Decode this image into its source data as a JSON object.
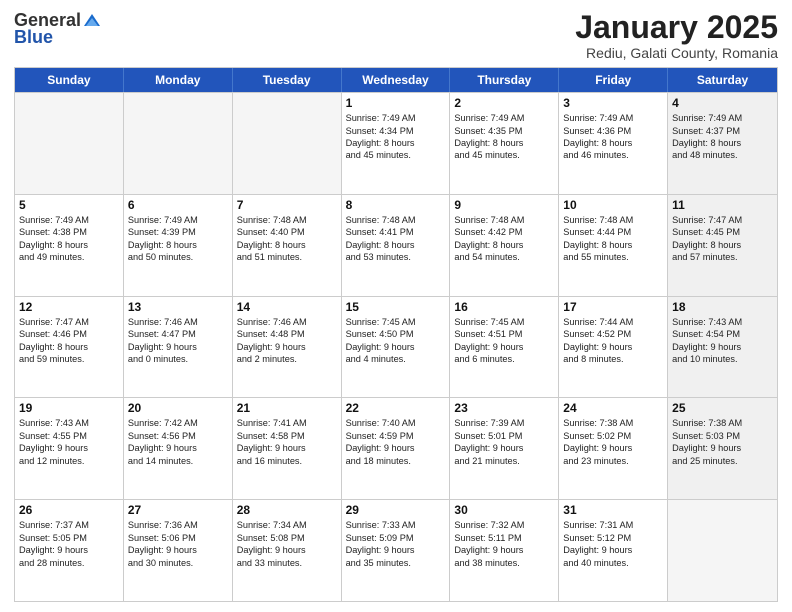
{
  "logo": {
    "general": "General",
    "blue": "Blue"
  },
  "title": "January 2025",
  "subtitle": "Rediu, Galati County, Romania",
  "headers": [
    "Sunday",
    "Monday",
    "Tuesday",
    "Wednesday",
    "Thursday",
    "Friday",
    "Saturday"
  ],
  "weeks": [
    [
      {
        "day": "",
        "lines": [],
        "empty": true
      },
      {
        "day": "",
        "lines": [],
        "empty": true
      },
      {
        "day": "",
        "lines": [],
        "empty": true
      },
      {
        "day": "1",
        "lines": [
          "Sunrise: 7:49 AM",
          "Sunset: 4:34 PM",
          "Daylight: 8 hours",
          "and 45 minutes."
        ],
        "empty": false
      },
      {
        "day": "2",
        "lines": [
          "Sunrise: 7:49 AM",
          "Sunset: 4:35 PM",
          "Daylight: 8 hours",
          "and 45 minutes."
        ],
        "empty": false
      },
      {
        "day": "3",
        "lines": [
          "Sunrise: 7:49 AM",
          "Sunset: 4:36 PM",
          "Daylight: 8 hours",
          "and 46 minutes."
        ],
        "empty": false
      },
      {
        "day": "4",
        "lines": [
          "Sunrise: 7:49 AM",
          "Sunset: 4:37 PM",
          "Daylight: 8 hours",
          "and 48 minutes."
        ],
        "empty": false,
        "shaded": true
      }
    ],
    [
      {
        "day": "5",
        "lines": [
          "Sunrise: 7:49 AM",
          "Sunset: 4:38 PM",
          "Daylight: 8 hours",
          "and 49 minutes."
        ],
        "empty": false
      },
      {
        "day": "6",
        "lines": [
          "Sunrise: 7:49 AM",
          "Sunset: 4:39 PM",
          "Daylight: 8 hours",
          "and 50 minutes."
        ],
        "empty": false
      },
      {
        "day": "7",
        "lines": [
          "Sunrise: 7:48 AM",
          "Sunset: 4:40 PM",
          "Daylight: 8 hours",
          "and 51 minutes."
        ],
        "empty": false
      },
      {
        "day": "8",
        "lines": [
          "Sunrise: 7:48 AM",
          "Sunset: 4:41 PM",
          "Daylight: 8 hours",
          "and 53 minutes."
        ],
        "empty": false
      },
      {
        "day": "9",
        "lines": [
          "Sunrise: 7:48 AM",
          "Sunset: 4:42 PM",
          "Daylight: 8 hours",
          "and 54 minutes."
        ],
        "empty": false
      },
      {
        "day": "10",
        "lines": [
          "Sunrise: 7:48 AM",
          "Sunset: 4:44 PM",
          "Daylight: 8 hours",
          "and 55 minutes."
        ],
        "empty": false
      },
      {
        "day": "11",
        "lines": [
          "Sunrise: 7:47 AM",
          "Sunset: 4:45 PM",
          "Daylight: 8 hours",
          "and 57 minutes."
        ],
        "empty": false,
        "shaded": true
      }
    ],
    [
      {
        "day": "12",
        "lines": [
          "Sunrise: 7:47 AM",
          "Sunset: 4:46 PM",
          "Daylight: 8 hours",
          "and 59 minutes."
        ],
        "empty": false
      },
      {
        "day": "13",
        "lines": [
          "Sunrise: 7:46 AM",
          "Sunset: 4:47 PM",
          "Daylight: 9 hours",
          "and 0 minutes."
        ],
        "empty": false
      },
      {
        "day": "14",
        "lines": [
          "Sunrise: 7:46 AM",
          "Sunset: 4:48 PM",
          "Daylight: 9 hours",
          "and 2 minutes."
        ],
        "empty": false
      },
      {
        "day": "15",
        "lines": [
          "Sunrise: 7:45 AM",
          "Sunset: 4:50 PM",
          "Daylight: 9 hours",
          "and 4 minutes."
        ],
        "empty": false
      },
      {
        "day": "16",
        "lines": [
          "Sunrise: 7:45 AM",
          "Sunset: 4:51 PM",
          "Daylight: 9 hours",
          "and 6 minutes."
        ],
        "empty": false
      },
      {
        "day": "17",
        "lines": [
          "Sunrise: 7:44 AM",
          "Sunset: 4:52 PM",
          "Daylight: 9 hours",
          "and 8 minutes."
        ],
        "empty": false
      },
      {
        "day": "18",
        "lines": [
          "Sunrise: 7:43 AM",
          "Sunset: 4:54 PM",
          "Daylight: 9 hours",
          "and 10 minutes."
        ],
        "empty": false,
        "shaded": true
      }
    ],
    [
      {
        "day": "19",
        "lines": [
          "Sunrise: 7:43 AM",
          "Sunset: 4:55 PM",
          "Daylight: 9 hours",
          "and 12 minutes."
        ],
        "empty": false
      },
      {
        "day": "20",
        "lines": [
          "Sunrise: 7:42 AM",
          "Sunset: 4:56 PM",
          "Daylight: 9 hours",
          "and 14 minutes."
        ],
        "empty": false
      },
      {
        "day": "21",
        "lines": [
          "Sunrise: 7:41 AM",
          "Sunset: 4:58 PM",
          "Daylight: 9 hours",
          "and 16 minutes."
        ],
        "empty": false
      },
      {
        "day": "22",
        "lines": [
          "Sunrise: 7:40 AM",
          "Sunset: 4:59 PM",
          "Daylight: 9 hours",
          "and 18 minutes."
        ],
        "empty": false
      },
      {
        "day": "23",
        "lines": [
          "Sunrise: 7:39 AM",
          "Sunset: 5:01 PM",
          "Daylight: 9 hours",
          "and 21 minutes."
        ],
        "empty": false
      },
      {
        "day": "24",
        "lines": [
          "Sunrise: 7:38 AM",
          "Sunset: 5:02 PM",
          "Daylight: 9 hours",
          "and 23 minutes."
        ],
        "empty": false
      },
      {
        "day": "25",
        "lines": [
          "Sunrise: 7:38 AM",
          "Sunset: 5:03 PM",
          "Daylight: 9 hours",
          "and 25 minutes."
        ],
        "empty": false,
        "shaded": true
      }
    ],
    [
      {
        "day": "26",
        "lines": [
          "Sunrise: 7:37 AM",
          "Sunset: 5:05 PM",
          "Daylight: 9 hours",
          "and 28 minutes."
        ],
        "empty": false
      },
      {
        "day": "27",
        "lines": [
          "Sunrise: 7:36 AM",
          "Sunset: 5:06 PM",
          "Daylight: 9 hours",
          "and 30 minutes."
        ],
        "empty": false
      },
      {
        "day": "28",
        "lines": [
          "Sunrise: 7:34 AM",
          "Sunset: 5:08 PM",
          "Daylight: 9 hours",
          "and 33 minutes."
        ],
        "empty": false
      },
      {
        "day": "29",
        "lines": [
          "Sunrise: 7:33 AM",
          "Sunset: 5:09 PM",
          "Daylight: 9 hours",
          "and 35 minutes."
        ],
        "empty": false
      },
      {
        "day": "30",
        "lines": [
          "Sunrise: 7:32 AM",
          "Sunset: 5:11 PM",
          "Daylight: 9 hours",
          "and 38 minutes."
        ],
        "empty": false
      },
      {
        "day": "31",
        "lines": [
          "Sunrise: 7:31 AM",
          "Sunset: 5:12 PM",
          "Daylight: 9 hours",
          "and 40 minutes."
        ],
        "empty": false
      },
      {
        "day": "",
        "lines": [],
        "empty": true,
        "shaded": true
      }
    ]
  ]
}
